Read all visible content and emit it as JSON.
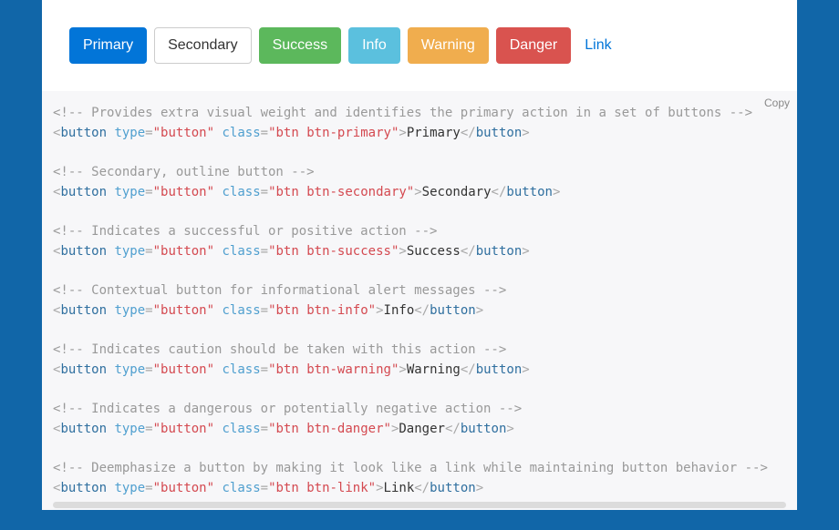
{
  "buttons": {
    "primary": "Primary",
    "secondary": "Secondary",
    "success": "Success",
    "info": "Info",
    "warning": "Warning",
    "danger": "Danger",
    "link": "Link"
  },
  "copy_label": "Copy",
  "code": {
    "tag": "button",
    "attr_type": "type",
    "attr_class": "class",
    "val_type": "\"button\"",
    "class_values": {
      "primary": "\"btn btn-primary\"",
      "secondary": "\"btn btn-secondary\"",
      "success": "\"btn btn-success\"",
      "info": "\"btn btn-info\"",
      "warning": "\"btn btn-warning\"",
      "danger": "\"btn btn-danger\"",
      "link": "\"btn btn-link\""
    },
    "inner": {
      "primary": "Primary",
      "secondary": "Secondary",
      "success": "Success",
      "info": "Info",
      "warning": "Warning",
      "danger": "Danger",
      "link": "Link"
    },
    "comments": {
      "primary": "<!-- Provides extra visual weight and identifies the primary action in a set of buttons -->",
      "secondary": "<!-- Secondary, outline button -->",
      "success": "<!-- Indicates a successful or positive action -->",
      "info": "<!-- Contextual button for informational alert messages -->",
      "warning": "<!-- Indicates caution should be taken with this action -->",
      "danger": "<!-- Indicates a dangerous or potentially negative action -->",
      "link": "<!-- Deemphasize a button by making it look like a link while maintaining button behavior -->"
    },
    "punct": {
      "lt": "<",
      "gt": ">",
      "lts": "</",
      "eq": "=",
      "sp": " "
    }
  }
}
